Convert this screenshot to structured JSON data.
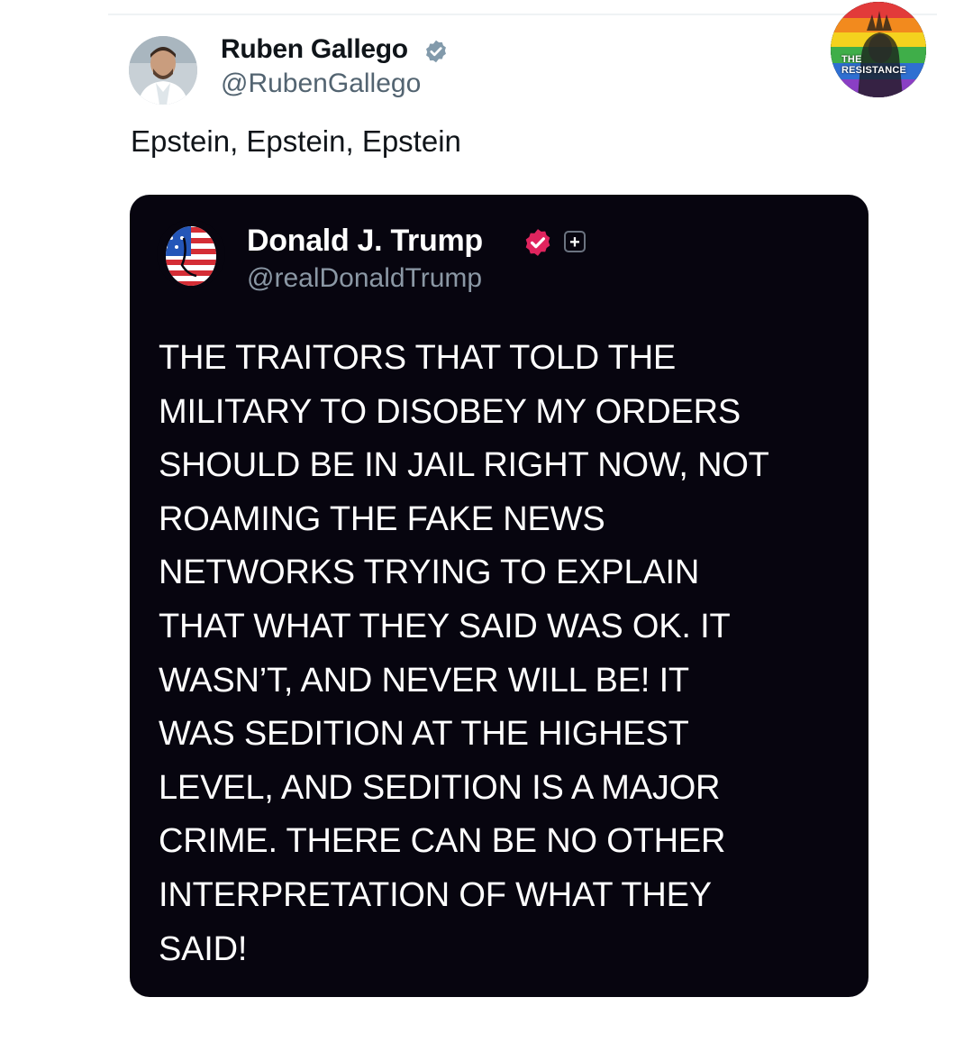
{
  "tweet": {
    "author": {
      "name": "Ruben Gallego",
      "handle": "@RubenGallego",
      "verified_color": "#829aab"
    },
    "text": "Epstein, Epstein, Epstein"
  },
  "badge": {
    "line1": "THE",
    "line2": "RESISTANCE"
  },
  "quoted_post": {
    "author": {
      "name": "Donald J. Trump",
      "handle": "@realDonaldTrump",
      "verified_color": "#e0245e"
    },
    "plus_symbol": "+",
    "body": "THE TRAITORS THAT TOLD THE\nMILITARY TO DISOBEY MY ORDERS\nSHOULD BE IN JAIL RIGHT NOW, NOT\nROAMING THE FAKE NEWS\nNETWORKS TRYING TO EXPLAIN\nTHAT WHAT THEY SAID WAS OK. IT\nWASN’T, AND NEVER WILL BE! IT\nWAS SEDITION AT THE HIGHEST\nLEVEL, AND SEDITION IS A MAJOR\nCRIME. THERE CAN BE NO OTHER\nINTERPRETATION OF WHAT THEY\nSAID!"
  },
  "icons": [
    "avatar",
    "verified-badge-icon",
    "resistance-logo",
    "plus-icon"
  ]
}
